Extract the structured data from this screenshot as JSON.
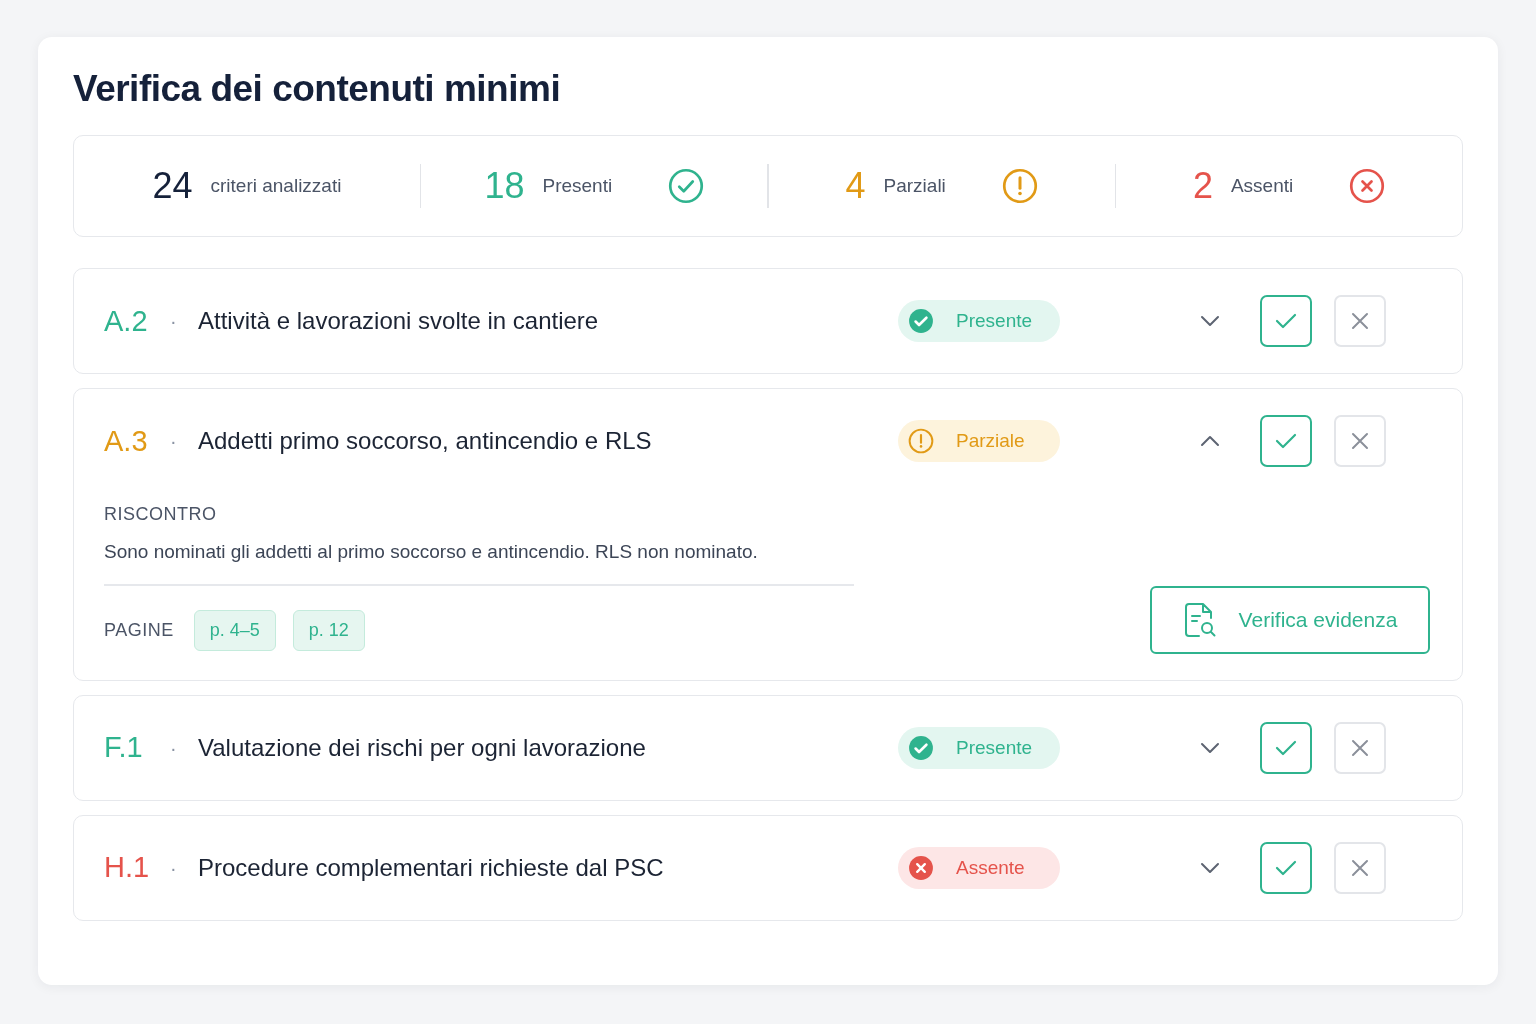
{
  "title": "Verifica dei contenuti minimi",
  "summary": [
    {
      "kind": "total",
      "value": "24",
      "label": "criteri analizzati"
    },
    {
      "kind": "present",
      "value": "18",
      "label": "Presenti"
    },
    {
      "kind": "partial",
      "value": "4",
      "label": "Parziali"
    },
    {
      "kind": "absent",
      "value": "2",
      "label": "Assenti"
    }
  ],
  "criteria": [
    {
      "code": "A.2",
      "separator": "·",
      "title": "Attività e lavorazioni svolte in cantiere",
      "status": {
        "kind": "present",
        "label": "Presente"
      },
      "expanded": false
    },
    {
      "code": "A.3",
      "separator": "·",
      "title": "Addetti primo soccorso, antincendio e RLS",
      "status": {
        "kind": "partial",
        "label": "Parziale"
      },
      "expanded": true,
      "details": {
        "heading": "RISCONTRO",
        "text": "Sono nominati gli addetti al primo soccorso e antincendio. RLS non nominato.",
        "pages_label": "PAGINE",
        "pages": [
          "p. 4–5",
          "p. 12"
        ],
        "button": "Verifica evidenza"
      }
    },
    {
      "code": "F.1",
      "separator": "·",
      "title": "Valutazione dei rischi per ogni lavorazione",
      "status": {
        "kind": "present",
        "label": "Presente"
      },
      "expanded": false
    },
    {
      "code": "H.1",
      "separator": "·",
      "title": "Procedure complementari richieste dal PSC",
      "status": {
        "kind": "absent",
        "label": "Assente"
      },
      "expanded": false
    }
  ]
}
